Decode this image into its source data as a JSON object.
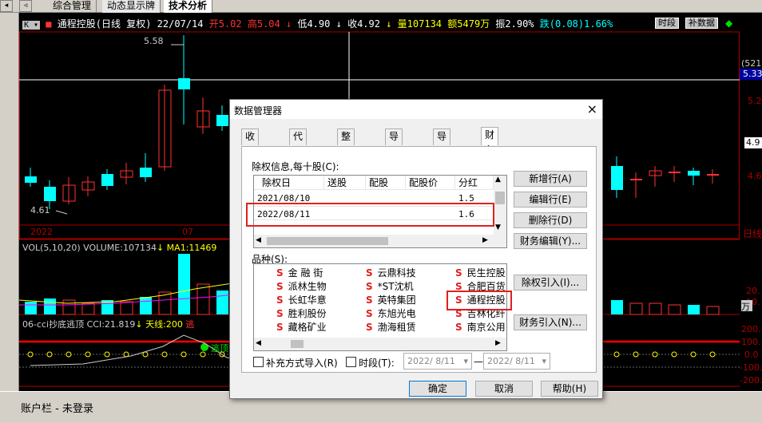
{
  "tabs": {
    "items": [
      {
        "label": "综合管理"
      },
      {
        "label": "动态显示牌"
      },
      {
        "label": "技术分析"
      }
    ]
  },
  "chart_header": {
    "stock": "通程控股(日线 复权) 22/07/14",
    "open": "开5.02",
    "high": "高5.04",
    "low": "低4.90",
    "close": "收4.92",
    "volume": "量107134",
    "amount": "额5479万",
    "amplitude": "振2.90%",
    "change": "跌(0.08)1.66%",
    "btn_period": "时段",
    "btn_fill": "补数据"
  },
  "chart_labels": {
    "high_mark": "5.58",
    "low_mark": "4.61",
    "year_label": "2022",
    "month_label": "07",
    "vol_line": "VOL(5,10,20) VOLUME:107134",
    "vol_ma1": "MA1:11469",
    "cci_line": "06-cci抄底逃顶 CCI:21.819",
    "cci_tianxian": "天线:200",
    "cci_escape": "逃",
    "cci_escape_marker": "逃顶"
  },
  "right_axis": {
    "p1": "(521",
    "p2": "5.33",
    "p3": "5.2",
    "p4": "4.9",
    "p5": "4.6",
    "daily": "日线",
    "v1": "20.",
    "v2": "10.",
    "wan": "万",
    "c1": "200.",
    "c2": "100.",
    "c3": "0.0",
    "c4": "-100.",
    "c5": "-200."
  },
  "status_bar": {
    "account": "账户栏 - 未登录"
  },
  "dialog": {
    "title": "数据管理器",
    "close": "×",
    "tabs": [
      "收盘清盘",
      "代码对照",
      "整理数据",
      "导出数据",
      "导入数据",
      "财务除权"
    ],
    "active_tab": 5,
    "rights_label": "除权信息,每十股(C):",
    "columns": [
      "除权日",
      "送股",
      "配股",
      "配股价",
      "分红"
    ],
    "rows": [
      {
        "date": "2021/08/10",
        "give": "",
        "allot": "",
        "price": "",
        "dividend": "1.5"
      },
      {
        "date": "2022/08/11",
        "give": "",
        "allot": "",
        "price": "",
        "dividend": "1.6"
      }
    ],
    "btn_new_row": "新增行(A)",
    "btn_edit_row": "编辑行(E)",
    "btn_delete_row": "删除行(D)",
    "btn_fin_edit": "财务编辑(Y)...",
    "variety_label": "品种(S):",
    "stock_marker": "S",
    "stocks_col1": [
      "金 融 街",
      "派林生物",
      "长虹华意",
      "胜利股份",
      "藏格矿业"
    ],
    "stocks_col2": [
      "云鼎科技",
      "*ST沈机",
      "英特集团",
      "东旭光电",
      "渤海租赁"
    ],
    "stocks_col3": [
      "民生控股",
      "合肥百货",
      "通程控股",
      "吉林化纤",
      "南京公用"
    ],
    "btn_rights_import": "除权引入(I)...",
    "btn_fin_import": "财务引入(N)...",
    "chk_supplement": "补充方式导入(R)",
    "chk_period": "时段(T):",
    "date_from": "2022/ 8/11",
    "date_to": "2022/ 8/11",
    "dash": "—",
    "btn_ok": "确定",
    "btn_cancel": "取消",
    "btn_help": "帮助(H)"
  },
  "colors": {
    "up": "#ff3232",
    "down": "#00ffff",
    "highlight_box": "#e0201c",
    "dialog_bg": "#f0f0f0"
  }
}
